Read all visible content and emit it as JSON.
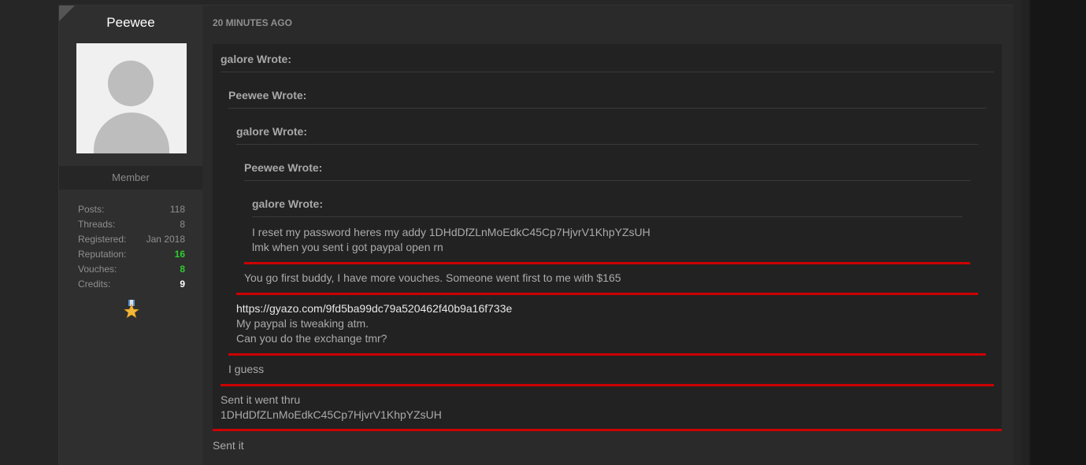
{
  "author": {
    "username": "Peewee",
    "rank": "Member",
    "stats": [
      {
        "label": "Posts:",
        "value": "118",
        "style": "normal"
      },
      {
        "label": "Threads:",
        "value": "8",
        "style": "normal"
      },
      {
        "label": "Registered:",
        "value": "Jan 2018",
        "style": "normal"
      },
      {
        "label": "Reputation:",
        "value": "16",
        "style": "green"
      },
      {
        "label": "Vouches:",
        "value": "8",
        "style": "green"
      },
      {
        "label": "Credits:",
        "value": "9",
        "style": "white"
      }
    ],
    "award_icon": "star-medal-icon"
  },
  "post": {
    "timestamp": "20 MINUTES AGO",
    "quotes": [
      {
        "header": "galore Wrote:"
      },
      {
        "header": "Peewee Wrote:"
      },
      {
        "header": "galore Wrote:"
      },
      {
        "header": "Peewee Wrote:"
      },
      {
        "header": "galore Wrote:"
      }
    ],
    "innermost_text": [
      "I reset my password heres my addy 1DHdDfZLnMoEdkC45Cp7HjvrV1KhpYZsUH",
      "lmk when you sent i got paypal open rn"
    ],
    "level4_text": "You go first buddy, I have more vouches. Someone went first to me with $165",
    "level3_link": "https://gyazo.com/9fd5ba99dc79a520462f40b9a16f733e",
    "level3_text": [
      "My paypal is tweaking atm.",
      "Can you do the exchange tmr?"
    ],
    "level2_text": "I guess",
    "level1_text": [
      "Sent it went thru",
      "1DHdDfZLnMoEdkC45Cp7HjvrV1KhpYZsUH"
    ],
    "reply_text": "Sent it"
  },
  "colors": {
    "accent_red": "#cc0000",
    "rep_green": "#2ecc2e"
  }
}
